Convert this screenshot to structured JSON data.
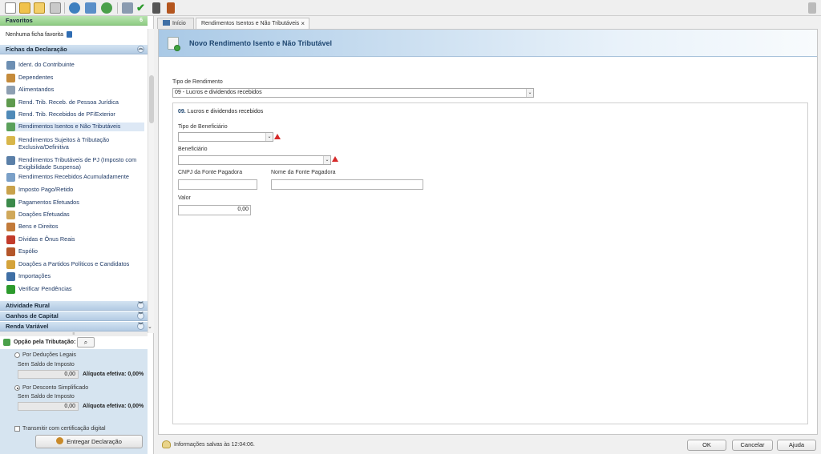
{
  "toolbar": {
    "icons": [
      "new-file-icon",
      "open-folder-icon",
      "folder-icon",
      "trash-icon",
      "import-icon",
      "transmit-icon",
      "globe-icon",
      "print-icon",
      "check-icon",
      "calculator-icon",
      "book-icon",
      "exit-icon"
    ]
  },
  "sidebar": {
    "favorites": {
      "title": "Favoritos",
      "count": "6",
      "empty_text": "Nenhuma ficha favorita"
    },
    "fichas": {
      "title": "Fichas da Declaração",
      "items": [
        {
          "label": "Ident. do Contribuinte"
        },
        {
          "label": "Dependentes"
        },
        {
          "label": "Alimentandos"
        },
        {
          "label": "Rend. Trib. Receb. de Pessoa Jurídica"
        },
        {
          "label": "Rend. Trib. Recebidos de PF/Exterior"
        },
        {
          "label": "Rendimentos Isentos e Não Tributáveis"
        },
        {
          "label": "Rendimentos Sujeitos à Tributação Exclusiva/Definitiva"
        },
        {
          "label": "Rendimentos Tributáveis de PJ (Imposto com Exigibilidade Suspensa)"
        },
        {
          "label": "Rendimentos Recebidos Acumuladamente"
        },
        {
          "label": "Imposto Pago/Retido"
        },
        {
          "label": "Pagamentos Efetuados"
        },
        {
          "label": "Doações Efetuadas"
        },
        {
          "label": "Bens e Direitos"
        },
        {
          "label": "Dívidas e Ônus Reais"
        },
        {
          "label": "Espólio"
        },
        {
          "label": "Doações a Partidos Políticos e Candidatos"
        },
        {
          "label": "Importações"
        },
        {
          "label": "Verificar Pendências"
        }
      ]
    },
    "atividade_rural": "Atividade Rural",
    "ganhos_capital": "Ganhos de Capital",
    "renda_variavel": "Renda Variável",
    "option": {
      "title": "Opção pela Tributação:",
      "deducoes_label": "Por Deduções Legais",
      "saldo_label_1": "Sem Saldo de Imposto",
      "saldo_value_1": "0,00",
      "aliquota_1": "Alíquota efetiva: 0,00%",
      "simplificado_label": "Por Desconto Simplificado",
      "saldo_label_2": "Sem Saldo de Imposto",
      "saldo_value_2": "0,00",
      "aliquota_2": "Alíquota efetiva: 0,00%",
      "transmitir_label": "Transmitir com certificação digital",
      "entregar_label": "Entregar Declaração"
    }
  },
  "tabs": [
    {
      "label": "Início"
    },
    {
      "label": "Rendimentos Isentos e Não Tributáveis",
      "close": "×"
    }
  ],
  "form": {
    "title": "Novo Rendimento Isento e Não Tributável",
    "tipo_label": "Tipo de Rendimento",
    "tipo_value": "09 - Lucros e dividendos recebidos",
    "section_num": "09.",
    "section_title": "Lucros e dividendos recebidos",
    "beneficiario_tipo_label": "Tipo de Beneficiário",
    "beneficiario_tipo_value": "",
    "beneficiario_label": "Beneficiário",
    "beneficiario_value": "",
    "cnpj_label": "CNPJ da Fonte Pagadora",
    "cnpj_value": "",
    "nome_label": "Nome da Fonte Pagadora",
    "nome_value": "",
    "valor_label": "Valor",
    "valor_value": "0,00"
  },
  "status": {
    "text": "Informações salvas às 12:04:06.",
    "ok": "OK",
    "cancel": "Cancelar",
    "help": "Ajuda"
  }
}
